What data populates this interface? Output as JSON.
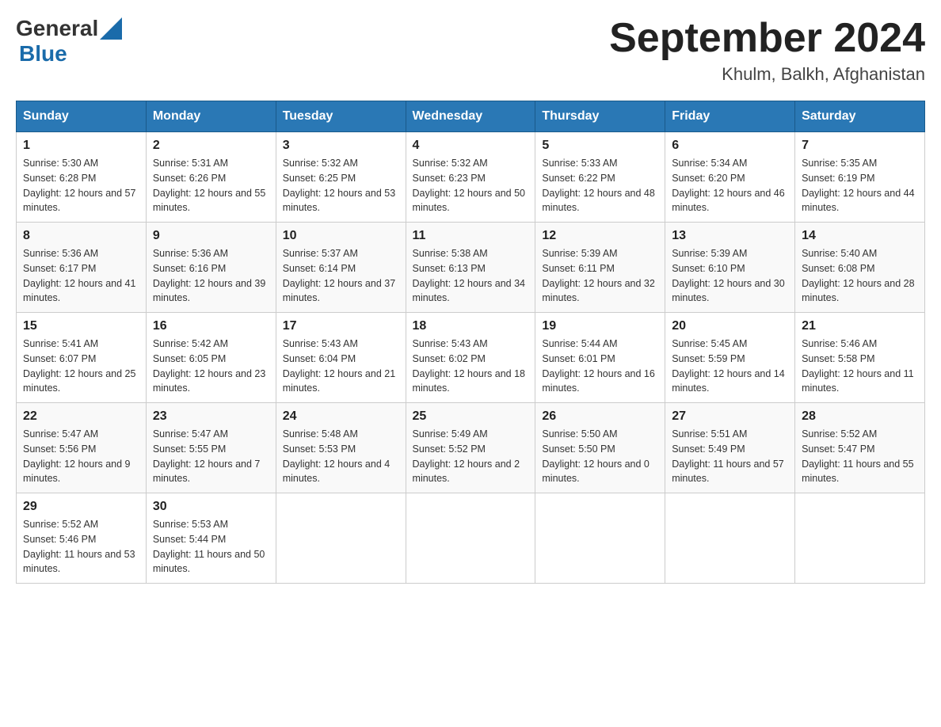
{
  "logo": {
    "text_general": "General",
    "text_blue": "Blue"
  },
  "title": "September 2024",
  "subtitle": "Khulm, Balkh, Afghanistan",
  "days_of_week": [
    "Sunday",
    "Monday",
    "Tuesday",
    "Wednesday",
    "Thursday",
    "Friday",
    "Saturday"
  ],
  "weeks": [
    [
      {
        "day": "1",
        "sunrise": "5:30 AM",
        "sunset": "6:28 PM",
        "daylight": "12 hours and 57 minutes."
      },
      {
        "day": "2",
        "sunrise": "5:31 AM",
        "sunset": "6:26 PM",
        "daylight": "12 hours and 55 minutes."
      },
      {
        "day": "3",
        "sunrise": "5:32 AM",
        "sunset": "6:25 PM",
        "daylight": "12 hours and 53 minutes."
      },
      {
        "day": "4",
        "sunrise": "5:32 AM",
        "sunset": "6:23 PM",
        "daylight": "12 hours and 50 minutes."
      },
      {
        "day": "5",
        "sunrise": "5:33 AM",
        "sunset": "6:22 PM",
        "daylight": "12 hours and 48 minutes."
      },
      {
        "day": "6",
        "sunrise": "5:34 AM",
        "sunset": "6:20 PM",
        "daylight": "12 hours and 46 minutes."
      },
      {
        "day": "7",
        "sunrise": "5:35 AM",
        "sunset": "6:19 PM",
        "daylight": "12 hours and 44 minutes."
      }
    ],
    [
      {
        "day": "8",
        "sunrise": "5:36 AM",
        "sunset": "6:17 PM",
        "daylight": "12 hours and 41 minutes."
      },
      {
        "day": "9",
        "sunrise": "5:36 AM",
        "sunset": "6:16 PM",
        "daylight": "12 hours and 39 minutes."
      },
      {
        "day": "10",
        "sunrise": "5:37 AM",
        "sunset": "6:14 PM",
        "daylight": "12 hours and 37 minutes."
      },
      {
        "day": "11",
        "sunrise": "5:38 AM",
        "sunset": "6:13 PM",
        "daylight": "12 hours and 34 minutes."
      },
      {
        "day": "12",
        "sunrise": "5:39 AM",
        "sunset": "6:11 PM",
        "daylight": "12 hours and 32 minutes."
      },
      {
        "day": "13",
        "sunrise": "5:39 AM",
        "sunset": "6:10 PM",
        "daylight": "12 hours and 30 minutes."
      },
      {
        "day": "14",
        "sunrise": "5:40 AM",
        "sunset": "6:08 PM",
        "daylight": "12 hours and 28 minutes."
      }
    ],
    [
      {
        "day": "15",
        "sunrise": "5:41 AM",
        "sunset": "6:07 PM",
        "daylight": "12 hours and 25 minutes."
      },
      {
        "day": "16",
        "sunrise": "5:42 AM",
        "sunset": "6:05 PM",
        "daylight": "12 hours and 23 minutes."
      },
      {
        "day": "17",
        "sunrise": "5:43 AM",
        "sunset": "6:04 PM",
        "daylight": "12 hours and 21 minutes."
      },
      {
        "day": "18",
        "sunrise": "5:43 AM",
        "sunset": "6:02 PM",
        "daylight": "12 hours and 18 minutes."
      },
      {
        "day": "19",
        "sunrise": "5:44 AM",
        "sunset": "6:01 PM",
        "daylight": "12 hours and 16 minutes."
      },
      {
        "day": "20",
        "sunrise": "5:45 AM",
        "sunset": "5:59 PM",
        "daylight": "12 hours and 14 minutes."
      },
      {
        "day": "21",
        "sunrise": "5:46 AM",
        "sunset": "5:58 PM",
        "daylight": "12 hours and 11 minutes."
      }
    ],
    [
      {
        "day": "22",
        "sunrise": "5:47 AM",
        "sunset": "5:56 PM",
        "daylight": "12 hours and 9 minutes."
      },
      {
        "day": "23",
        "sunrise": "5:47 AM",
        "sunset": "5:55 PM",
        "daylight": "12 hours and 7 minutes."
      },
      {
        "day": "24",
        "sunrise": "5:48 AM",
        "sunset": "5:53 PM",
        "daylight": "12 hours and 4 minutes."
      },
      {
        "day": "25",
        "sunrise": "5:49 AM",
        "sunset": "5:52 PM",
        "daylight": "12 hours and 2 minutes."
      },
      {
        "day": "26",
        "sunrise": "5:50 AM",
        "sunset": "5:50 PM",
        "daylight": "12 hours and 0 minutes."
      },
      {
        "day": "27",
        "sunrise": "5:51 AM",
        "sunset": "5:49 PM",
        "daylight": "11 hours and 57 minutes."
      },
      {
        "day": "28",
        "sunrise": "5:52 AM",
        "sunset": "5:47 PM",
        "daylight": "11 hours and 55 minutes."
      }
    ],
    [
      {
        "day": "29",
        "sunrise": "5:52 AM",
        "sunset": "5:46 PM",
        "daylight": "11 hours and 53 minutes."
      },
      {
        "day": "30",
        "sunrise": "5:53 AM",
        "sunset": "5:44 PM",
        "daylight": "11 hours and 50 minutes."
      },
      null,
      null,
      null,
      null,
      null
    ]
  ]
}
